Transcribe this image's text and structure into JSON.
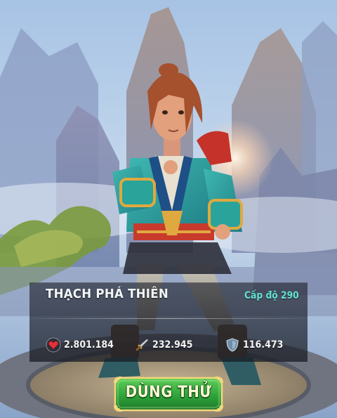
{
  "hero": {
    "name": "THẠCH PHÁ THIÊN",
    "level_label": "Cấp độ 290"
  },
  "stats": {
    "hp": {
      "icon": "heart-icon",
      "value": "2.801.184"
    },
    "attack": {
      "icon": "sword-icon",
      "value": "232.945"
    },
    "defense": {
      "icon": "shield-icon",
      "value": "116.473"
    }
  },
  "actions": {
    "try_label": "DÙNG THỬ"
  },
  "colors": {
    "accent_level": "#63e2d6",
    "button_green": "#2fa33a",
    "button_border": "#f2d77a"
  }
}
